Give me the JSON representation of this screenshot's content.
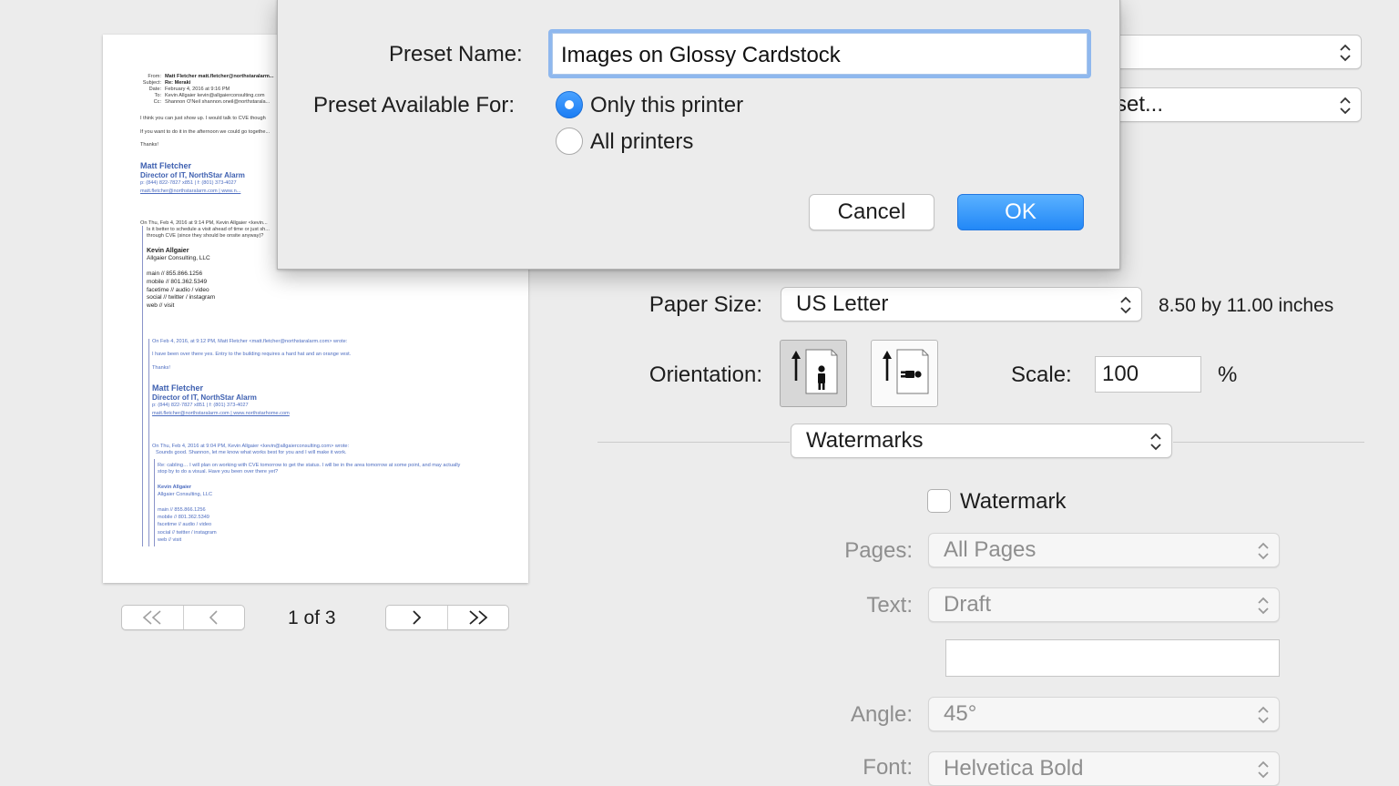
{
  "preview": {
    "lines": {
      "from_label": "From:",
      "from_value": "Matt Fletcher matt.fletcher@northstaralarm...",
      "subject_label": "Subject:",
      "subject_value": "Re: Meraki",
      "date_label": "Date:",
      "date_value": "February 4, 2016 at 9:16 PM",
      "to_label": "To:",
      "to_value": "Kevin Allgaier kevin@allgaierconsulting.com",
      "cc_label": "Cc:",
      "cc_value": "Shannon O'Neil shannon.oneil@northstarala...",
      "body1": "I think you can just show up. I would talk to CVE though",
      "body2": "If you want to do it in the afternoon we could go togethe...",
      "thanks": "Thanks!",
      "sig_name": "Matt Fletcher",
      "sig_title": "Director of IT, NorthStar Alarm",
      "sig_phone": "p: (844) 822-7827 x851 | f: (801) 373-4027",
      "sig_links": "matt.fletcher@northstaralarm.com | www.n...",
      "quote1": "On Thu, Feb 4, 2016 at 9:14 PM, Kevin Allgaier <kevin...",
      "quote1_b1": "Is it better to schedule a visit ahead of time or just sh...",
      "quote1_b2": "through CVE (since they should be onsite anyway)?",
      "kevin_name": "Kevin Allgaier",
      "kevin_company": "Allgaier Consulting, LLC",
      "kevin_main": "main // 855.866.1256",
      "kevin_mobile": "mobile // 801.362.5349",
      "kevin_facetime": "facetime // audio / video",
      "kevin_social": "social // twitter / instagram",
      "kevin_web": "web // visit",
      "quote2": "On Feb 4, 2016, at 9:12 PM, Matt Fletcher <matt.fletcher@northstaralarm.com> wrote:",
      "quote2_body": "I have been over there yes. Entry to the building requires a hard hat and an orange vest.",
      "thanks2": "Thanks!",
      "sig2_name": "Matt Fletcher",
      "sig2_title": "Director of IT, NorthStar Alarm",
      "sig2_phone": "p: (844) 822-7827 x851 | f: (801) 373-4027",
      "sig2_links": "matt.fletcher@northstaralarm.com | www.northstarhome.com",
      "quote3": "On Thu, Feb 4, 2016 at 9:04 PM, Kevin Allgaier <kevin@allgaierconsulting.com> wrote:",
      "quote3_body": "Sounds good. Shannon, let me know what works best for you and I will make it work.",
      "quote4_b1": "Re: cabling… I will plan on working with CVE tomorrow to get the status. I will be in the area tomorrow at some point, and may actually",
      "quote4_b2": "stop by to do a visual. Have you been over there yet?",
      "kevin2_name": "Kevin Allgaier",
      "kevin2_company": "Allgaier Consulting, LLC",
      "kevin2_main": "main // 855.866.1256",
      "kevin2_mobile": "mobile // 801.362.5349",
      "kevin2_facetime": "facetime // audio / video",
      "kevin2_social": "social // twitter / instagram",
      "kevin2_web": "web // visit"
    }
  },
  "pagination": {
    "first": "<<",
    "prev": "<",
    "indicator": "1 of 3",
    "next": ">",
    "last": ">>"
  },
  "settings": {
    "top_popup2_visible": "set...",
    "paper_size_label": "Paper Size:",
    "paper_size_value": "US Letter",
    "paper_size_dims": "8.50 by 11.00 inches",
    "orientation_label": "Orientation:",
    "scale_label": "Scale:",
    "scale_value": "100",
    "scale_unit": "%",
    "section_value": "Watermarks",
    "watermark_label": "Watermark",
    "watermark_checked": false,
    "pages_label": "Pages:",
    "pages_value": "All Pages",
    "text_label": "Text:",
    "text_value": "Draft",
    "angle_label": "Angle:",
    "angle_value": "45°",
    "font_label": "Font:",
    "font_value": "Helvetica Bold"
  },
  "sheet": {
    "preset_name_label": "Preset Name:",
    "preset_name_value": "Images on Glossy Cardstock",
    "available_label": "Preset Available For:",
    "option_only": "Only this printer",
    "option_all": "All printers",
    "selected": "Only this printer",
    "cancel": "Cancel",
    "ok": "OK"
  },
  "colors": {
    "accent": "#2288f7",
    "focus_ring": "#8fb8ee",
    "link_blue": "#4c6cc0"
  }
}
